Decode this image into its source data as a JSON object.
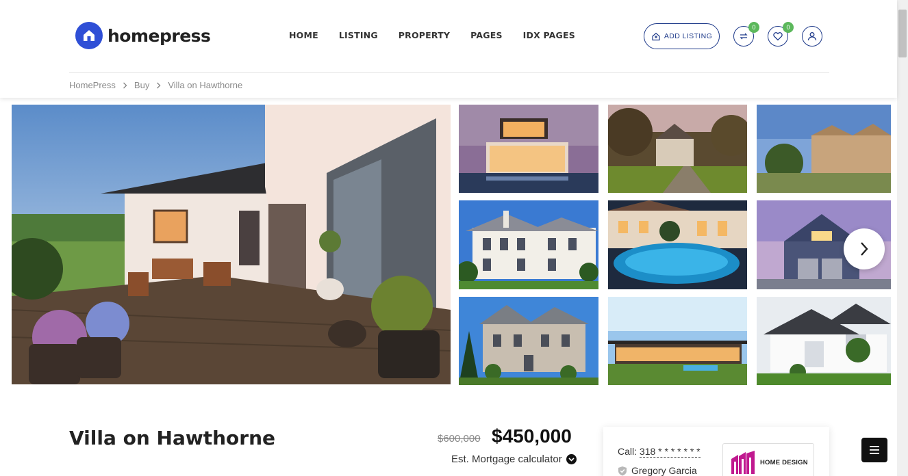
{
  "brand": {
    "name": "homepress",
    "color": "#2f4fd6"
  },
  "nav": {
    "items": [
      "HOME",
      "LISTING",
      "PROPERTY",
      "PAGES",
      "IDX PAGES"
    ]
  },
  "header_actions": {
    "add_listing_label": "ADD LISTING",
    "compare_count": "0",
    "favorites_count": "0"
  },
  "breadcrumb": {
    "items": [
      "HomePress",
      "Buy"
    ],
    "current": "Villa on Hawthorne"
  },
  "gallery": {
    "hero": "patio-villa-photo",
    "thumbnails": [
      "modern-house-photo",
      "manor-path-photo",
      "castle-estate-photo",
      "white-mansion-photo",
      "pool-villa-photo",
      "blue-house-photo",
      "stone-house-photo",
      "flat-roof-house-photo",
      "white-house-photo"
    ]
  },
  "listing": {
    "title": "Villa on Hawthorne",
    "old_price": "$600,000",
    "price": "$450,000",
    "mortgage_label": "Est. Mortgage calculator"
  },
  "agent": {
    "call_label": "Call:",
    "phone": "318 * * * * * * *",
    "name": "Gregory Garcia",
    "agency": "HOME DESIGN",
    "agency_color": "#c0198f"
  },
  "colors": {
    "accent": "#1e3a8a",
    "badge": "#5cb85c"
  }
}
